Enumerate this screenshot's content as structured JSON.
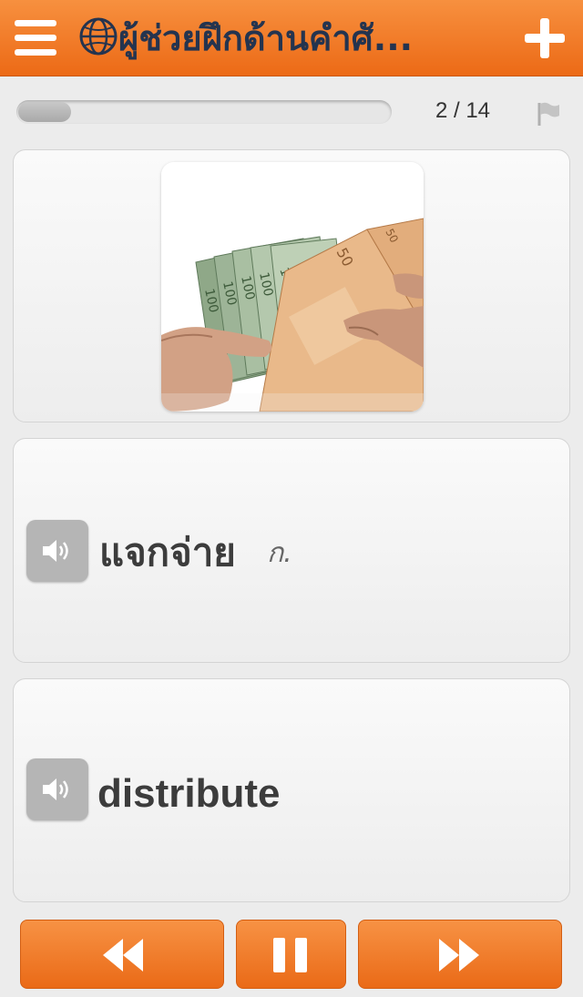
{
  "header": {
    "title": "ผู้ช่วยฝึกด้านคำศั...",
    "menu_icon": "hamburger-menu-icon",
    "logo_icon": "globe-icon",
    "add_icon": "plus-icon"
  },
  "progress": {
    "current": 2,
    "total": 14,
    "fraction": 0.143,
    "counter_text": "2 / 14",
    "flag_icon": "flag-icon"
  },
  "card_image": {
    "description_icon": "euro-banknotes-photo"
  },
  "card_thai": {
    "word": "แจกจ่าย",
    "part_of_speech": "ก.",
    "audio_icon": "speaker-icon"
  },
  "card_english": {
    "word": "distribute",
    "audio_icon": "speaker-icon"
  },
  "controls": {
    "prev_icon": "rewind-icon",
    "pause_icon": "pause-icon",
    "next_icon": "fast-forward-icon"
  },
  "colors": {
    "accent": "#ef7a2a",
    "title_text": "#24344f",
    "speaker_bg": "#b5b5b5"
  }
}
